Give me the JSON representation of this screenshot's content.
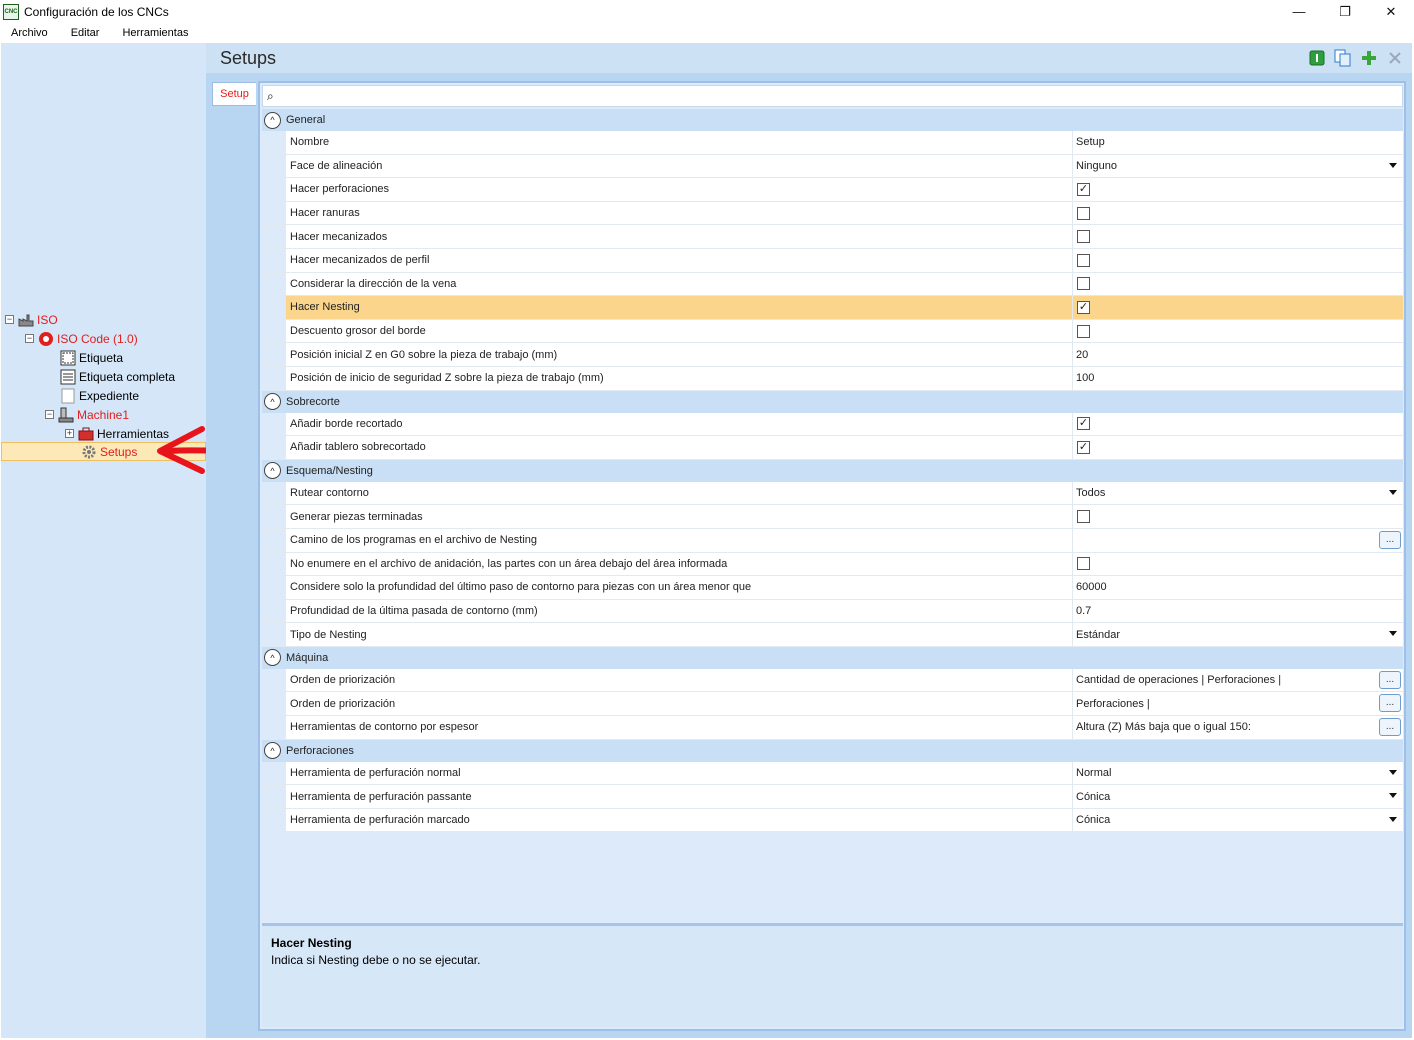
{
  "window": {
    "icon_text": "CNC",
    "title": "Configuración de los CNCs",
    "minimize": "—",
    "restore": "❐",
    "close": "✕"
  },
  "menu": [
    "Archivo",
    "Editar",
    "Herramientas"
  ],
  "tree": {
    "root": "ISO",
    "isocode": "ISO Code (1.0)",
    "etiqueta": "Etiqueta",
    "etiqueta_completa": "Etiqueta completa",
    "expediente": "Expediente",
    "machine": "Machine1",
    "herramientas": "Herramientas",
    "setups": "Setups",
    "collapse_glyph": "−",
    "expand_glyph": "+"
  },
  "header": {
    "title": "Setups",
    "accent_color": "#e0201e"
  },
  "tab": {
    "label": "Setup"
  },
  "search": {
    "icon": "⌕"
  },
  "categories": [
    {
      "name": "General",
      "rows": [
        {
          "name": "Nombre",
          "type": "text",
          "value": "Setup"
        },
        {
          "name": "Face de alineación",
          "type": "dropdown",
          "value": "Ninguno"
        },
        {
          "name": "Hacer perforaciones",
          "type": "check",
          "checked": true
        },
        {
          "name": "Hacer ranuras",
          "type": "check",
          "checked": false
        },
        {
          "name": "Hacer mecanizados",
          "type": "check",
          "checked": false
        },
        {
          "name": "Hacer mecanizados de perfil",
          "type": "check",
          "checked": false
        },
        {
          "name": "Considerar la dirección de la vena",
          "type": "check",
          "checked": false
        },
        {
          "name": "Hacer Nesting",
          "type": "check",
          "checked": true,
          "highlight": true
        },
        {
          "name": "Descuento grosor del borde",
          "type": "check",
          "checked": false
        },
        {
          "name": "Posición inicial Z en G0 sobre la pieza de trabajo (mm)",
          "type": "text",
          "value": "20"
        },
        {
          "name": "Posición de inicio de seguridad Z sobre la pieza de trabajo (mm)",
          "type": "text",
          "value": "100"
        }
      ]
    },
    {
      "name": "Sobrecorte",
      "rows": [
        {
          "name": "Añadir borde recortado",
          "type": "check",
          "checked": true
        },
        {
          "name": "Añadir tablero sobrecortado",
          "type": "check",
          "checked": true
        }
      ]
    },
    {
      "name": "Esquema/Nesting",
      "rows": [
        {
          "name": "Rutear contorno",
          "type": "dropdown",
          "value": "Todos"
        },
        {
          "name": "Generar piezas terminadas",
          "type": "check",
          "checked": false
        },
        {
          "name": "Camino de los programas en el archivo de Nesting",
          "type": "ellipsis",
          "value": ""
        },
        {
          "name": "No enumere en el archivo de anidación, las partes con un área debajo del área informada",
          "type": "check",
          "checked": false
        },
        {
          "name": "Considere solo la profundidad del último paso de contorno para piezas con un área menor que",
          "type": "text",
          "value": "60000"
        },
        {
          "name": "Profundidad de la última pasada de contorno (mm)",
          "type": "text",
          "value": "0.7"
        },
        {
          "name": "Tipo de Nesting",
          "type": "dropdown",
          "value": "Estándar"
        }
      ]
    },
    {
      "name": "Máquina",
      "rows": [
        {
          "name": "Orden de priorización",
          "type": "ellipsis",
          "value": "Cantidad de operaciones | Perforaciones |"
        },
        {
          "name": "Orden de priorización",
          "type": "ellipsis",
          "value": "Perforaciones |"
        },
        {
          "name": "Herramientas de contorno por espesor",
          "type": "ellipsis",
          "value": "Altura (Z) Más baja que o igual 150:"
        }
      ]
    },
    {
      "name": "Perforaciones",
      "rows": [
        {
          "name": "Herramienta de perfuración normal",
          "type": "dropdown",
          "value": "Normal"
        },
        {
          "name": "Herramienta de perfuración passante",
          "type": "dropdown",
          "value": "Cónica"
        },
        {
          "name": "Herramienta de perfuración marcado",
          "type": "dropdown",
          "value": "Cónica"
        }
      ]
    }
  ],
  "description": {
    "title": "Hacer Nesting",
    "text": "Indica si Nesting debe o no se ejecutar."
  },
  "glyphs": {
    "check": "✓",
    "collapse": "^",
    "ellipsis": "..."
  }
}
